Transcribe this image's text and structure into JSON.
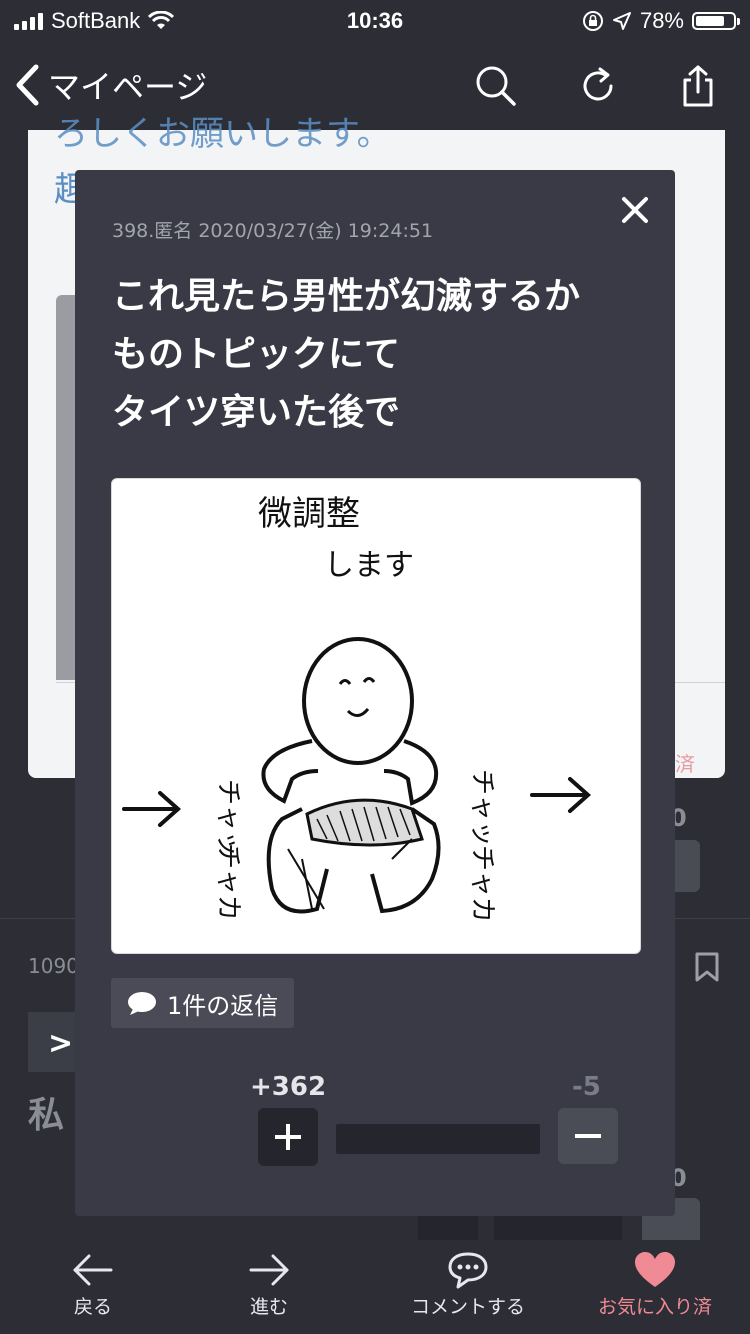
{
  "status_bar": {
    "carrier": "SoftBank",
    "time": "10:36",
    "battery": "78%",
    "battery_level": 0.78
  },
  "nav": {
    "back_label": "マイページ",
    "icons": [
      "search-icon",
      "reload-icon",
      "share-icon"
    ]
  },
  "background": {
    "card_text_line1": "ろしくお願いします。",
    "card_text_line2": "趣",
    "card_favorite": "済",
    "comment_number": "1090",
    "quote_mark": ">",
    "comment_start": "私",
    "count_top": "0",
    "count_bottom": "0"
  },
  "modal": {
    "meta": "398.匿名 2020/03/27(金) 19:24:51",
    "body_lines": [
      "これ見たら男性が幻滅するか",
      "ものトピックにて",
      "タイツ穿いた後で"
    ],
    "image": {
      "title_line1": "微調整",
      "title_line2": "します",
      "left_sfx1": "チャッ",
      "left_sfx2": "チャカ",
      "right_sfx1": "チャッ",
      "right_sfx2": "チャカ"
    },
    "reply_label": "1件の返信",
    "plus_count": "+362",
    "minus_count": "-5"
  },
  "tabbar": {
    "back": "戻る",
    "forward": "進む",
    "comment": "コメントする",
    "favorite": "お気に入り済"
  },
  "colors": {
    "background": "#2c2d35",
    "modal": "#393a45",
    "favorite": "#f08a94",
    "link_blue": "#5b8fc4"
  }
}
